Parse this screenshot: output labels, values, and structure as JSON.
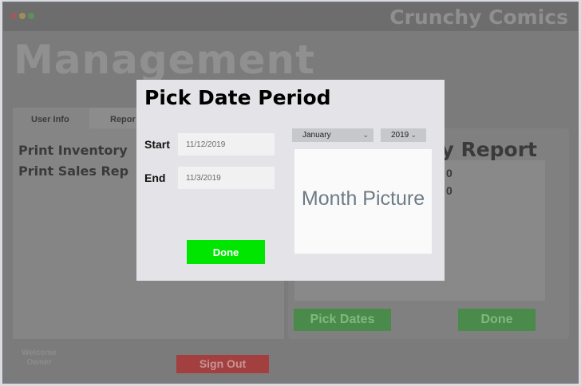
{
  "window": {
    "app_title": "Crunchy Comics",
    "heading": "Management",
    "tabs": [
      {
        "label": "User Info"
      },
      {
        "label": "Repor"
      }
    ],
    "left_panel": {
      "items": [
        {
          "label": "Print Inventory"
        },
        {
          "label": "Print Sales Rep"
        }
      ]
    },
    "right_panel": {
      "title": "y Report",
      "ghost_digits": [
        "0",
        "0"
      ],
      "pick_dates_label": "Pick Dates",
      "done_label": "Done"
    },
    "footer": {
      "welcome_line1": "Welcome",
      "welcome_line2": "Owner",
      "sign_out_label": "Sign Out"
    }
  },
  "dialog": {
    "title": "Pick Date Period",
    "start_label": "Start",
    "start_value": "11/12/2019",
    "end_label": "End",
    "end_value": "11/3/2019",
    "done_label": "Done",
    "month_select": {
      "value": "January"
    },
    "year_select": {
      "value": "2019"
    },
    "month_picture_text": "Month Picture"
  },
  "colors": {
    "done_green": "#00e600",
    "sign_out_red": "#a33f3f",
    "dialog_bg": "#e4e4e8"
  }
}
